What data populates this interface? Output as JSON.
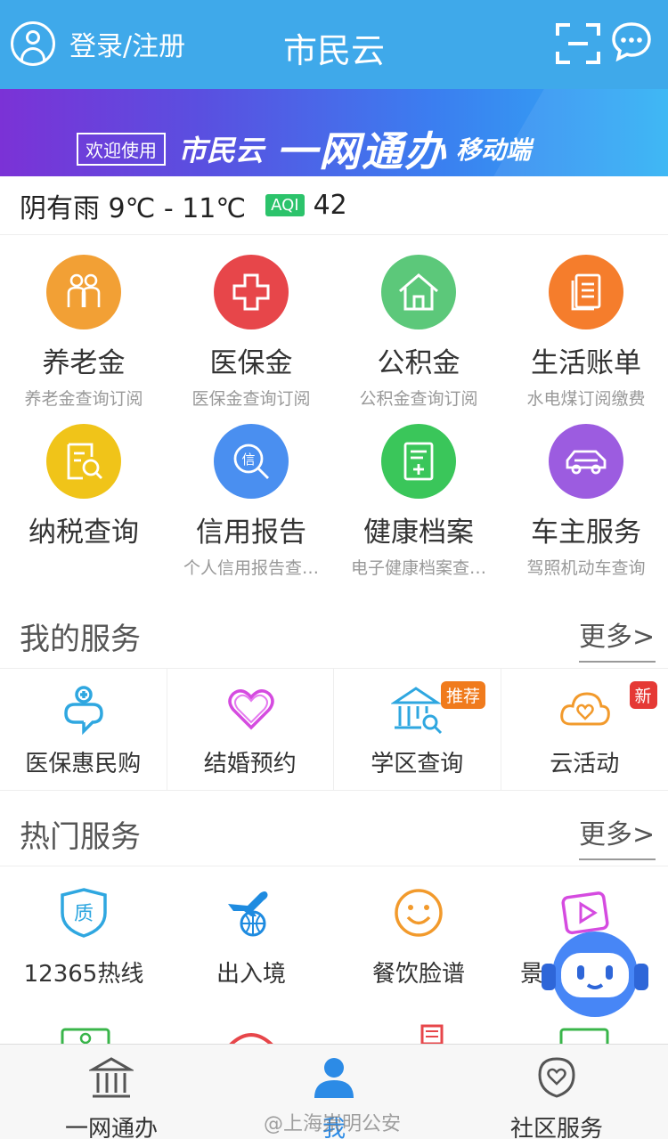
{
  "header": {
    "login_label": "登录/注册",
    "title": "市民云"
  },
  "banner": {
    "welcome": "欢迎使用",
    "brand": "市民云",
    "main": "一网通办",
    "mobile": "移动端"
  },
  "weather": {
    "text": "阴有雨 9℃ - 11℃",
    "aqi_label": "AQI",
    "aqi_value": "42"
  },
  "grid": [
    {
      "title": "养老金",
      "subtitle": "养老金查询订阅",
      "color": "#f2a035",
      "icon": "elderly-icon"
    },
    {
      "title": "医保金",
      "subtitle": "医保金查询订阅",
      "color": "#e7464a",
      "icon": "medical-cross-icon"
    },
    {
      "title": "公积金",
      "subtitle": "公积金查询订阅",
      "color": "#5cc87a",
      "icon": "house-icon"
    },
    {
      "title": "生活账单",
      "subtitle": "水电煤订阅缴费",
      "color": "#f57d2c",
      "icon": "bill-icon"
    },
    {
      "title": "纳税查询",
      "subtitle": "",
      "color": "#f0c419",
      "icon": "tax-search-icon"
    },
    {
      "title": "信用报告",
      "subtitle": "个人信用报告查…",
      "color": "#4a8ff0",
      "icon": "credit-icon"
    },
    {
      "title": "健康档案",
      "subtitle": "电子健康档案查…",
      "color": "#3ac65a",
      "icon": "health-record-icon"
    },
    {
      "title": "车主服务",
      "subtitle": "驾照机动车查询",
      "color": "#9c5ce0",
      "icon": "car-icon"
    }
  ],
  "my_services": {
    "title": "我的服务",
    "more": "更多>",
    "items": [
      {
        "label": "医保惠民购",
        "icon": "medical-shop-icon",
        "badge": ""
      },
      {
        "label": "结婚预约",
        "icon": "heart-icon",
        "badge": ""
      },
      {
        "label": "学区查询",
        "icon": "school-search-icon",
        "badge": "推荐"
      },
      {
        "label": "云活动",
        "icon": "cloud-heart-icon",
        "badge": "新"
      }
    ]
  },
  "hot_services": {
    "title": "热门服务",
    "more": "更多>",
    "items": [
      {
        "label": "12365热线",
        "icon": "quality-shield-icon"
      },
      {
        "label": "出入境",
        "icon": "plane-globe-icon"
      },
      {
        "label": "餐饮脸谱",
        "icon": "smiley-icon"
      },
      {
        "label": "景",
        "icon": "play-icon"
      }
    ]
  },
  "bottom_nav": [
    {
      "label": "一网通办",
      "icon": "government-building-icon",
      "active": false
    },
    {
      "label": "我",
      "icon": "person-icon",
      "active": true
    },
    {
      "label": "社区服务",
      "icon": "community-heart-icon",
      "active": false
    }
  ],
  "watermark": "@上海崇明公安",
  "colors": {
    "header_bg": "#3fa9ea",
    "badge_orange": "#f25b20",
    "badge_red": "#e53935",
    "active_blue": "#2c8be6"
  }
}
